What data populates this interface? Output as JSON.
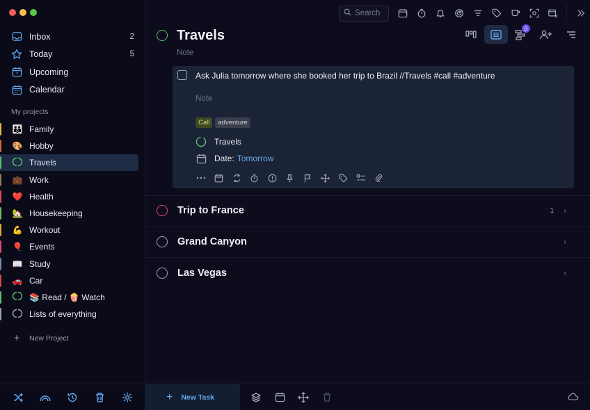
{
  "window": {
    "traffic_lights": [
      "#ee5f57",
      "#f6be4f",
      "#5ac64e"
    ]
  },
  "sidebar": {
    "nav": [
      {
        "label": "Inbox",
        "count": "2",
        "icon": "inbox-icon"
      },
      {
        "label": "Today",
        "count": "5",
        "icon": "star-icon"
      },
      {
        "label": "Upcoming",
        "count": "",
        "icon": "calendar-upcoming-icon"
      },
      {
        "label": "Calendar",
        "count": "",
        "icon": "calendar-grid-icon"
      }
    ],
    "section_label": "My projects",
    "projects": [
      {
        "label": "Family",
        "emoji": "👪",
        "color": "#e8b93a"
      },
      {
        "label": "Hobby",
        "emoji": "🎨",
        "color": "#d86a3a"
      },
      {
        "label": "Travels",
        "emoji": "",
        "color": "#5cc06b",
        "active": true
      },
      {
        "label": "Work",
        "emoji": "💼",
        "color": "#9a7b50"
      },
      {
        "label": "Health",
        "emoji": "❤️",
        "color": "#e04a5a"
      },
      {
        "label": "Housekeeping",
        "emoji": "🏡",
        "color": "#6bbf6a"
      },
      {
        "label": "Workout",
        "emoji": "💪",
        "color": "#e8a93a"
      },
      {
        "label": "Events",
        "emoji": "🎈",
        "color": "#e04a6a"
      },
      {
        "label": "Study",
        "emoji": "📖",
        "color": "#7a8aa8"
      },
      {
        "label": "Car",
        "emoji": "🚗",
        "color": "#d84a4a"
      },
      {
        "label": "📚 Read / 🍿 Watch",
        "emoji": "",
        "color": "#5cc06b"
      },
      {
        "label": "Lists of everything",
        "emoji": "",
        "color": "#9fa2b4"
      }
    ],
    "new_project_label": "New Project",
    "bottom_icons": [
      "shuffle-icon",
      "rainbow-icon",
      "history-icon",
      "trash-icon",
      "settings-icon"
    ]
  },
  "toolbar": {
    "search_placeholder": "Search",
    "icons": [
      "calendar-icon",
      "timer-icon",
      "bell-icon",
      "radar-icon",
      "filter-icon",
      "tag-icon",
      "cup-icon",
      "scan-icon",
      "add-window-icon",
      "expand-icon"
    ]
  },
  "main": {
    "title": "Travels",
    "note_placeholder": "Note",
    "beta_badge": "β",
    "view_icons": [
      "board-view-icon",
      "list-view-icon",
      "gantt-view-icon",
      "assign-user-icon",
      "sort-icon"
    ],
    "task": {
      "title": "Ask Julia tomorrow where she booked her trip to Brazil //Travels #call #adventure",
      "note_placeholder": "Note",
      "tags": [
        {
          "label": "Call",
          "bg": "#3e4a22",
          "fg": "#d0d878"
        },
        {
          "label": "adventure",
          "bg": "#3a3f4d",
          "fg": "#d0d0d8"
        }
      ],
      "project_label": "Travels",
      "date_label": "Date:",
      "date_value": "Tomorrow",
      "action_icons": [
        "more-icon",
        "calendar-icon",
        "repeat-icon",
        "timer-icon",
        "priority-icon",
        "pin-icon",
        "flag-icon",
        "move-icon",
        "tag-icon",
        "checklist-icon",
        "attachment-icon"
      ]
    },
    "subprojects": [
      {
        "label": "Trip to France",
        "count": "1",
        "circle_color": "#e0486a"
      },
      {
        "label": "Grand Canyon",
        "count": "",
        "circle_color": "#9fa2b4"
      },
      {
        "label": "Las Vegas",
        "count": "",
        "circle_color": "#9fa2b4"
      }
    ]
  },
  "bottom_bar": {
    "new_task_label": "New Task",
    "icons": [
      "layers-icon",
      "calendar-icon",
      "move-icon",
      "trash-icon",
      "cloud-icon"
    ]
  }
}
